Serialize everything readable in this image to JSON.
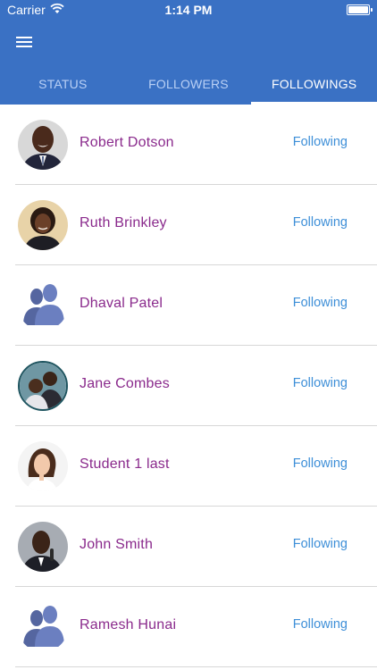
{
  "status_bar": {
    "carrier": "Carrier",
    "time": "1:14 PM"
  },
  "tabs": [
    {
      "label": "STATUS",
      "active": false
    },
    {
      "label": "FOLLOWERS",
      "active": false
    },
    {
      "label": "FOLLOWINGS",
      "active": true
    }
  ],
  "people": [
    {
      "name": "Robert Dotson",
      "action": "Following",
      "avatar": "photo"
    },
    {
      "name": "Ruth Brinkley",
      "action": "Following",
      "avatar": "photo"
    },
    {
      "name": "Dhaval Patel",
      "action": "Following",
      "avatar": "placeholder"
    },
    {
      "name": "Jane Combes",
      "action": "Following",
      "avatar": "photo"
    },
    {
      "name": "Student  1 last",
      "action": "Following",
      "avatar": "photo"
    },
    {
      "name": "John Smith",
      "action": "Following",
      "avatar": "photo"
    },
    {
      "name": "Ramesh Hunai",
      "action": "Following",
      "avatar": "placeholder"
    }
  ],
  "colors": {
    "header": "#3a71c4",
    "name": "#8a2a8c",
    "link": "#3e8fd8"
  }
}
